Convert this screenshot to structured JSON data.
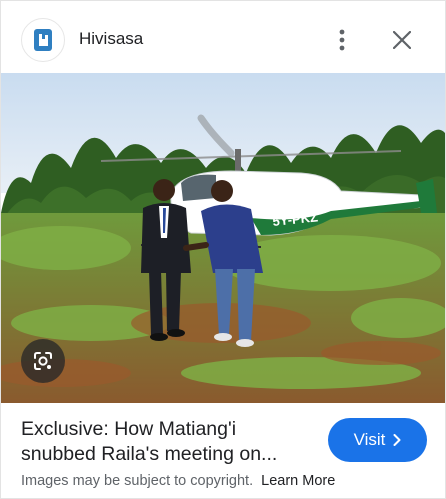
{
  "header": {
    "site_name": "Hivisasa",
    "favicon_icon": "hivisasa-logo-icon",
    "more_icon": "more-vert-icon",
    "close_icon": "close-icon"
  },
  "image": {
    "registration": "5Y-PKZ",
    "lens_icon": "google-lens-icon"
  },
  "caption": {
    "title_line1": "Exclusive: How Matiang'i",
    "title_line2": "snubbed Raila's meeting on..."
  },
  "visit_button": {
    "label": "Visit",
    "icon": "chevron-right-icon"
  },
  "copyright": {
    "text": "Images may be subject to copyright.",
    "link": "Learn More"
  },
  "colors": {
    "accent": "#1a73e8",
    "text_secondary": "#5f6368",
    "helicopter_green": "#1f7a3a"
  }
}
